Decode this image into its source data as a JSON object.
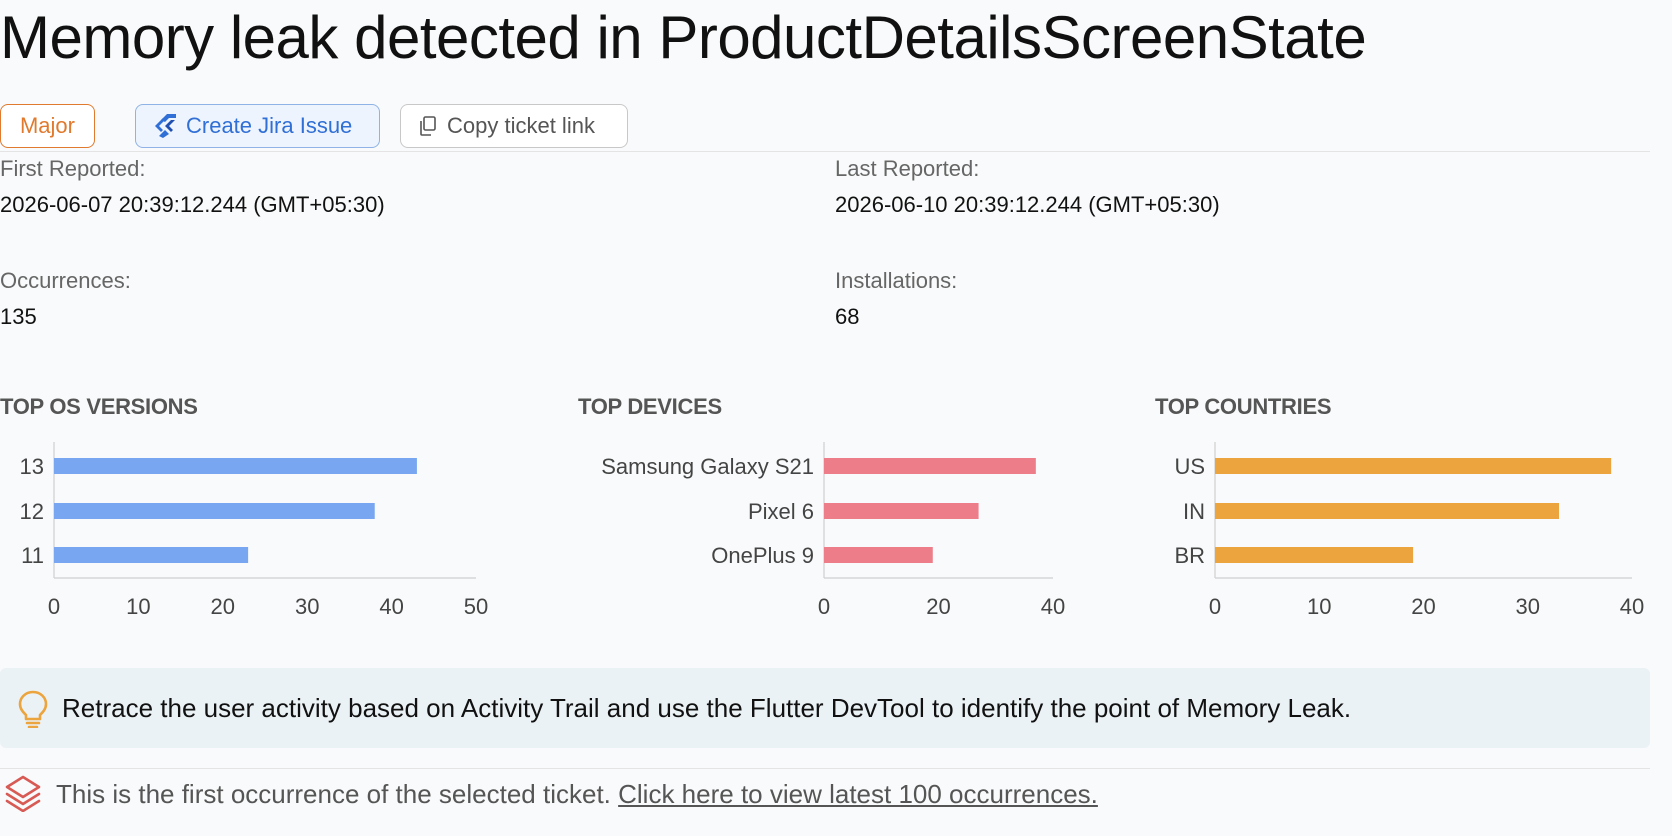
{
  "title": "Memory leak detected in ProductDetailsScreenState",
  "buttons": {
    "severity": "Major",
    "jira": "Create Jira Issue",
    "copy": "Copy ticket link"
  },
  "stats": {
    "first_reported_label": "First Reported:",
    "first_reported_value": "2026-06-07 20:39:12.244 (GMT+05:30)",
    "last_reported_label": "Last Reported:",
    "last_reported_value": "2026-06-10 20:39:12.244 (GMT+05:30)",
    "occurrences_label": "Occurrences:",
    "occurrences_value": "135",
    "installations_label": "Installations:",
    "installations_value": "68"
  },
  "colors": {
    "os": "#78a6f0",
    "devices": "#ee7d8a",
    "countries": "#eca43e",
    "severity": "#e07a2e",
    "jira": "#2f6fd6"
  },
  "chart_data": [
    {
      "type": "bar",
      "orientation": "horizontal",
      "title": "TOP OS VERSIONS",
      "categories": [
        "13",
        "12",
        "11"
      ],
      "values": [
        43,
        38,
        23
      ],
      "xlim": [
        0,
        50
      ],
      "xticks": [
        0,
        10,
        20,
        30,
        40,
        50
      ]
    },
    {
      "type": "bar",
      "orientation": "horizontal",
      "title": "TOP DEVICES",
      "categories": [
        "Samsung Galaxy S21",
        "Pixel 6",
        "OnePlus 9"
      ],
      "values": [
        37,
        27,
        19
      ],
      "xlim": [
        0,
        40
      ],
      "xticks": [
        0,
        20,
        40
      ]
    },
    {
      "type": "bar",
      "orientation": "horizontal",
      "title": "TOP COUNTRIES",
      "categories": [
        "US",
        "IN",
        "BR"
      ],
      "values": [
        38,
        33,
        19
      ],
      "xlim": [
        0,
        40
      ],
      "xticks": [
        0,
        10,
        20,
        30,
        40
      ]
    }
  ],
  "tip": {
    "icon": "lightbulb-icon",
    "text": "Retrace the user activity based on Activity Trail and use the Flutter DevTool to identify the point of Memory Leak."
  },
  "footer": {
    "icon": "layers-icon",
    "text": "This is the first occurrence of the selected ticket. ",
    "link": "Click here to view latest 100 occurrences."
  }
}
